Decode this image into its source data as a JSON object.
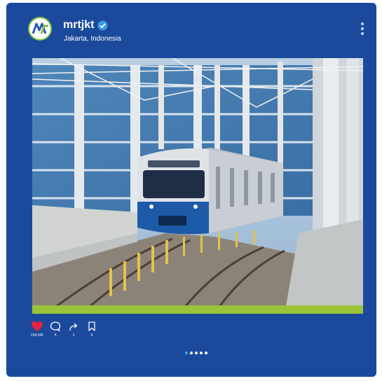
{
  "post": {
    "username": "mrtjkt",
    "location": "Jakarta, Indonesia",
    "verified": true
  },
  "image": {
    "subject": "MRT Jakarta train on elevated track"
  },
  "actions": {
    "likes": "234,541",
    "comments": "5",
    "shares": "1",
    "saves": "4"
  },
  "carousel": {
    "total": 5,
    "active_index": 0
  },
  "colors": {
    "card_background": "#1b4a9c",
    "like_red": "#e8233a",
    "accent_green": "#9bc43a",
    "verified_blue": "#3d9ae8",
    "active_dot": "#4aa3df"
  },
  "icons": [
    "logo-icon",
    "verified-icon",
    "more-options-icon",
    "heart-icon",
    "comment-icon",
    "share-icon",
    "bookmark-icon"
  ]
}
